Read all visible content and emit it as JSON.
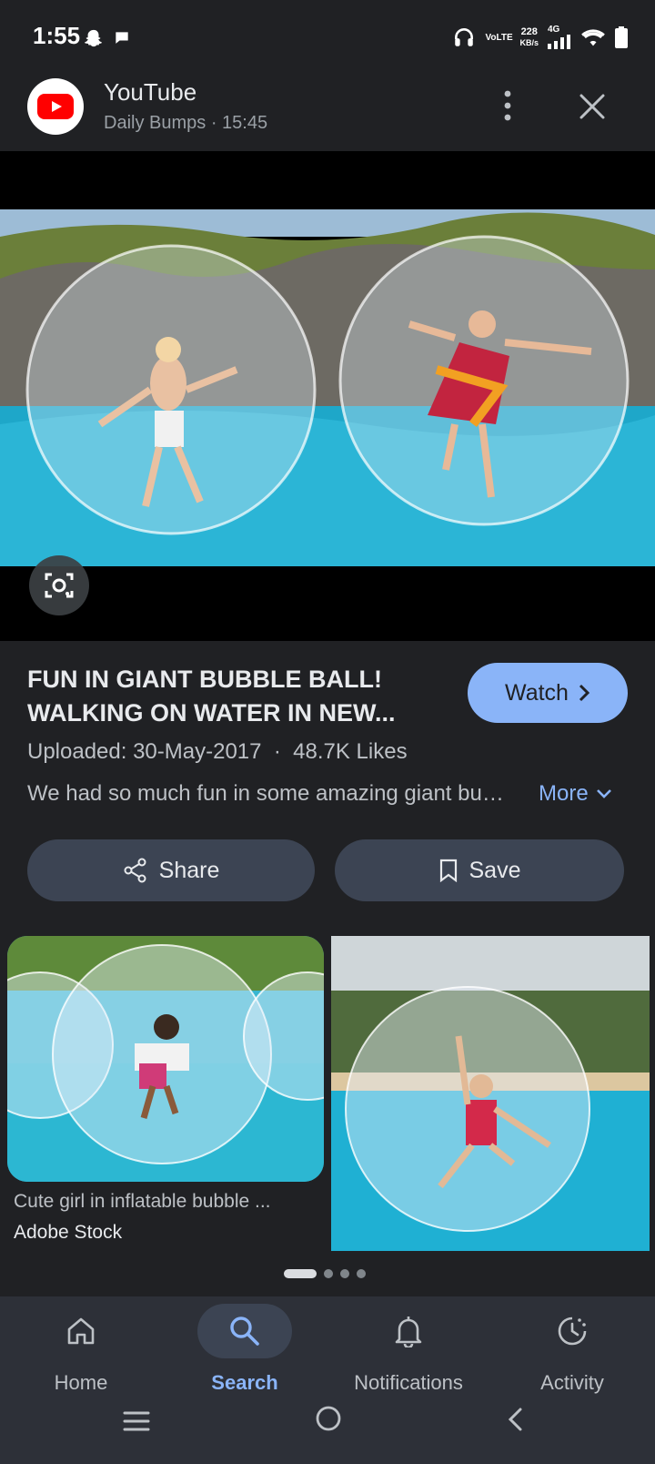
{
  "status_bar": {
    "time": "1:55",
    "network_label": "VoLTE",
    "speed_value": "228",
    "speed_unit": "KB/s",
    "net_type": "4G"
  },
  "header": {
    "source_name": "YouTube",
    "subtitle": "Daily Bumps · 15:45"
  },
  "video": {
    "title": "FUN IN GIANT BUBBLE BALL! WALKING ON WATER IN NEW...",
    "watch_label": "Watch",
    "meta": "Uploaded: 30-May-2017  ·  48.7K Likes",
    "description": "We had so much fun in some amazing giant bubble balls...",
    "more_label": "More"
  },
  "actions": {
    "share_label": "Share",
    "save_label": "Save"
  },
  "related": [
    {
      "title": "Cute girl in inflatable bubble ...",
      "source": "Adobe Stock"
    },
    {
      "title": "",
      "source": ""
    }
  ],
  "carousel": {
    "pages": 4,
    "active": 0
  },
  "bottom_nav": [
    {
      "label": "Home",
      "icon": "home-icon",
      "active": false
    },
    {
      "label": "Search",
      "icon": "search-icon",
      "active": true
    },
    {
      "label": "Notifications",
      "icon": "bell-icon",
      "active": false
    },
    {
      "label": "Activity",
      "icon": "activity-icon",
      "active": false
    }
  ],
  "colors": {
    "background": "#202124",
    "accent": "#8ab4f8",
    "pill": "#3c4453",
    "youtube_red": "#ff0000"
  }
}
